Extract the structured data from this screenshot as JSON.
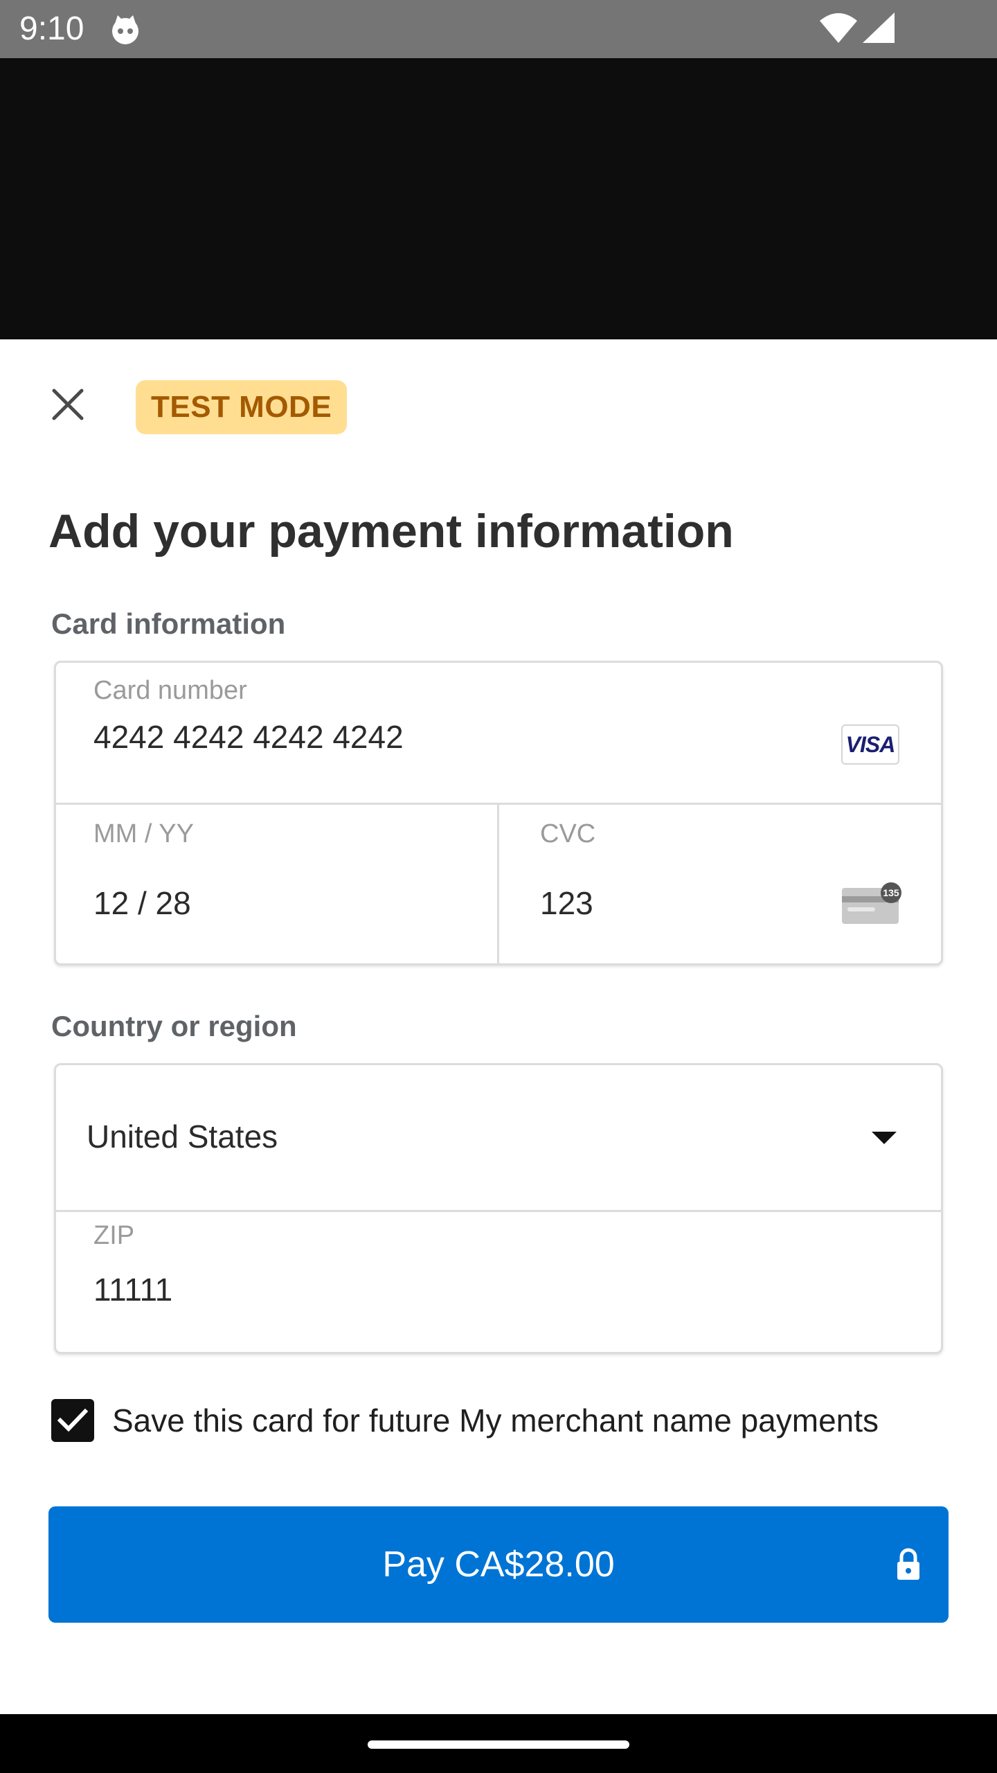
{
  "status_bar": {
    "time": "9:10",
    "icons": [
      "notification-cat-icon",
      "wifi-icon",
      "cellular-signal-icon"
    ]
  },
  "sheet": {
    "test_mode_badge": "TEST MODE",
    "title": "Add your payment information",
    "card_section": {
      "label": "Card information",
      "card_number": {
        "label": "Card number",
        "value": "4242 4242 4242 4242",
        "brand": "VISA"
      },
      "expiry": {
        "label": "MM / YY",
        "value": "12 / 28"
      },
      "cvc": {
        "label": "CVC",
        "value": "123",
        "icon_text": "135"
      }
    },
    "country_section": {
      "label": "Country or region",
      "country": {
        "value": "United States"
      },
      "zip": {
        "label": "ZIP",
        "value": "11111"
      }
    },
    "save_card": {
      "checked": true,
      "label": "Save this card for future My merchant name payments"
    },
    "pay_button": {
      "label": "Pay CA$28.00"
    }
  },
  "colors": {
    "status_bar": "#757575",
    "badge_bg": "#ffde92",
    "badge_text": "#a35a00",
    "pay_button": "#0074d4"
  }
}
